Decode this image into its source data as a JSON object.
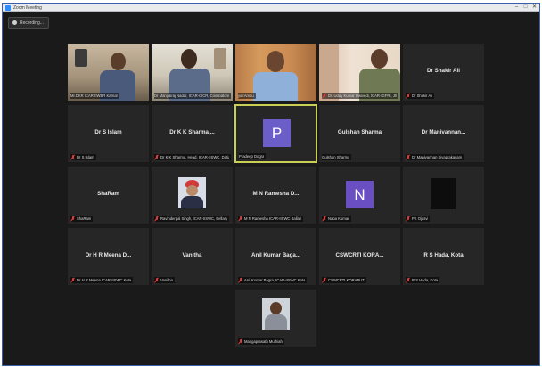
{
  "window": {
    "title": "Zoom Meeting",
    "controls": [
      "–",
      "□",
      "✕"
    ]
  },
  "recording": {
    "label": "Recording..."
  },
  "participants": [
    {
      "display": "video",
      "label": "Mr.DKR ICAR-IIWBR Karnal",
      "muted": false
    },
    {
      "display": "video",
      "label": "Dr Mangalraj Nadar, ICAR-CICR, Coimbatore",
      "muted": false
    },
    {
      "display": "video",
      "label": "yalrAmbu",
      "muted": false
    },
    {
      "display": "video",
      "label": "Dr. Uday Kumar Dwivedi, ICAR-IGFRI, Jhansi",
      "muted": false
    },
    {
      "display": "name",
      "name": "Dr Shakir Ali",
      "label": "Dr Shakir Ali",
      "muted": true
    },
    {
      "display": "name",
      "name": "Dr S Islam",
      "label": "Dr S Islam",
      "muted": true
    },
    {
      "display": "name",
      "name": "Dr K K Sharma,...",
      "label": "Dr K K Sharma, Head, ICAR-IISWC, Datia",
      "muted": true
    },
    {
      "display": "avatar",
      "letter": "P",
      "label": "Pradeep Dogra",
      "muted": false,
      "color": "#6b5ec9",
      "active": true
    },
    {
      "display": "name",
      "name": "Gulshan Sharma",
      "label": "Gulshan Sharma",
      "muted": false
    },
    {
      "display": "name",
      "name": "Dr Manivannan...",
      "label": "Dr Manivannan Sivaprakasam",
      "muted": true
    },
    {
      "display": "name",
      "name": "ShaRam",
      "label": "ShaRam",
      "muted": true
    },
    {
      "display": "photo",
      "label": "Ravinderpal Singh, ICAR-IISWC, Bellary",
      "muted": true
    },
    {
      "display": "name",
      "name": "M N Ramesha D...",
      "label": "M N Ramesha ICAR-IISWC Ballari",
      "muted": true
    },
    {
      "display": "avatar",
      "letter": "N",
      "label": "Naba Kumar",
      "muted": true,
      "color": "#6a4fc2"
    },
    {
      "display": "photo-dark",
      "label": "PK Ojasvi",
      "muted": true
    },
    {
      "display": "name",
      "name": "Dr H R Meena D...",
      "label": "Dr H R Meena ICAR-IISWC Kota",
      "muted": true
    },
    {
      "display": "name",
      "name": "Vanitha",
      "label": "Vanitha",
      "muted": true
    },
    {
      "display": "name",
      "name": "Anil Kumar Baga...",
      "label": "Anil Kumar Bagra, ICAR-IISWC Kota",
      "muted": true
    },
    {
      "display": "name",
      "name": "CSWCRTI KORA...",
      "label": "CSWCRTI KORAPUT",
      "muted": true
    },
    {
      "display": "name",
      "name": "R S Hada, Kota",
      "label": "R S Hada, Kota",
      "muted": true
    },
    {
      "display": "photo",
      "label": "Mangaprasath Muthiah",
      "muted": true
    }
  ]
}
